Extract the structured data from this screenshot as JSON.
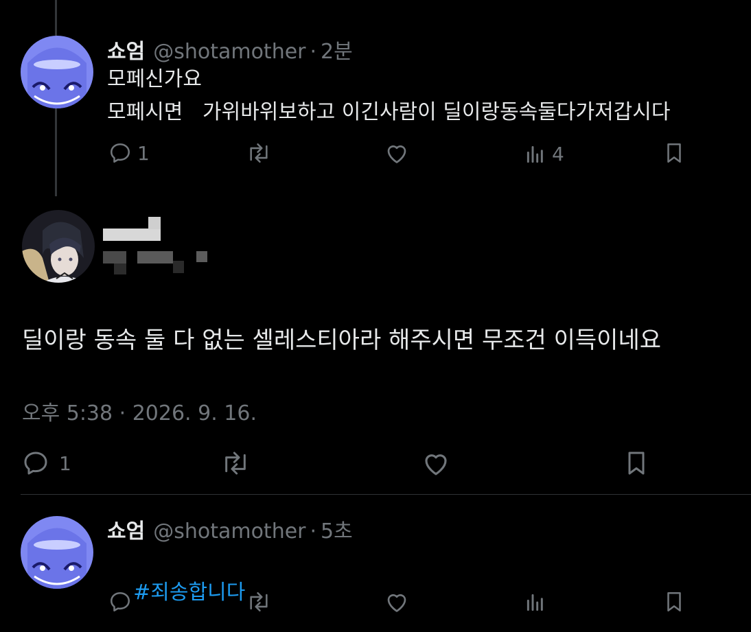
{
  "tweet1": {
    "name": "쇼엄",
    "handle": "@shotamother",
    "separator": "·",
    "time": "2분",
    "line1": "모페신가요",
    "line2": "모페시면   가위바위보하고 이긴사람이 딜이랑동속둘다가저갑시다",
    "reply_count": "1",
    "view_count": "4"
  },
  "focus": {
    "text": "딜이랑 동속 둘 다 없는 셀레스티아라 해주시면 무조건 이득이네요",
    "timestamp": "오후 5:38 · 2026. 9. 16.",
    "reply_count": "1"
  },
  "tweet2": {
    "name": "쇼엄",
    "handle": "@shotamother",
    "separator": "·",
    "time": "5초",
    "hashtag": "#죄송합니다"
  },
  "icons": {
    "reply": "reply-icon",
    "retweet": "retweet-icon",
    "like": "heart-icon",
    "views": "views-icon",
    "bookmark": "bookmark-icon"
  },
  "colors": {
    "background": "#000000",
    "text": "#e7e9ea",
    "muted": "#71767b",
    "link": "#1d9bf0",
    "divider": "#2f3336"
  }
}
